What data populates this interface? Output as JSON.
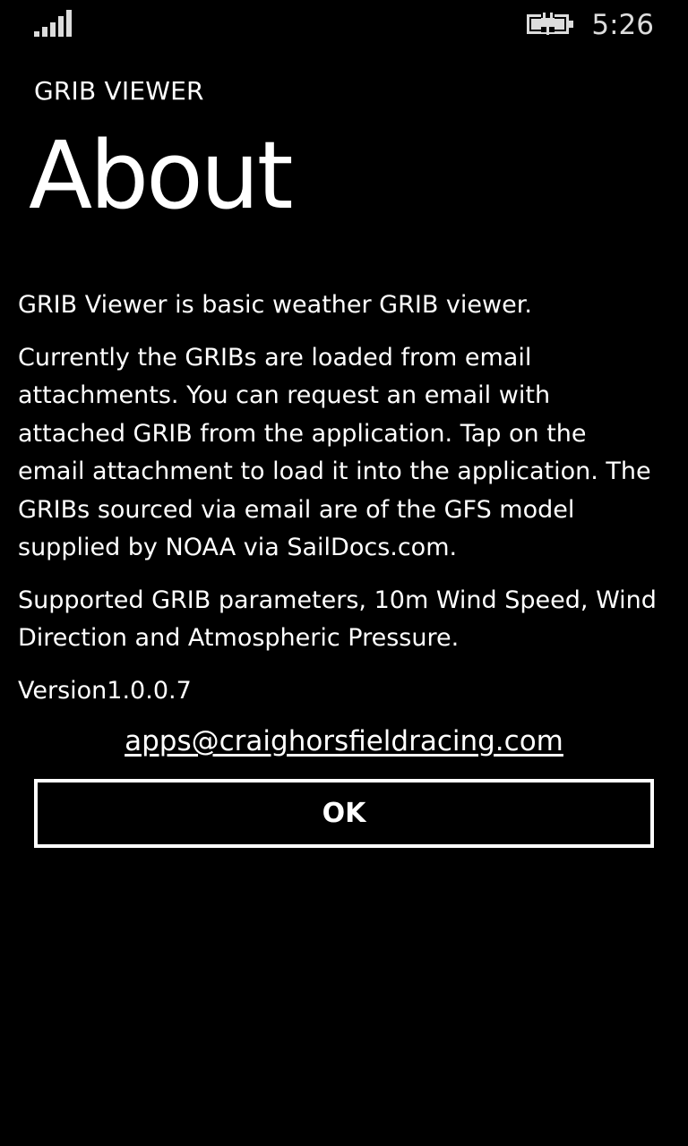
{
  "status_bar": {
    "signal_icon": "signal-strength-icon",
    "battery_icon": "battery-charging-icon",
    "time": "5:26"
  },
  "header": {
    "app_title": "GRIB VIEWER",
    "page_title": "About"
  },
  "content": {
    "intro": "GRIB Viewer is basic weather GRIB viewer.",
    "description": "Currently the GRIBs are loaded from email attachments. You can request an email with attached GRIB from the application. Tap on the email attachment to load it into the application. The GRIBs sourced via email are of the GFS model supplied by NOAA via SailDocs.com.",
    "parameters": "Supported GRIB parameters, 10m Wind Speed, Wind Direction and Atmospheric Pressure.",
    "version_label": "Version",
    "version_number": "1.0.0.7",
    "email": "apps@craighorsfieldracing.com"
  },
  "actions": {
    "ok_label": "OK"
  }
}
